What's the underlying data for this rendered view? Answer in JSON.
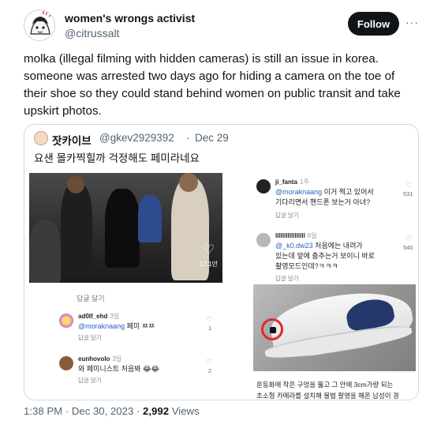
{
  "author": {
    "name": "women's wrongs activist",
    "handle": "@citrussalt"
  },
  "follow_label": "Follow",
  "more_label": "···",
  "tweet_text": "molka (illegal filming with hidden cameras) is still an issue in korea. someone was arrested two days ago for hiding a camera on the toe of their shoe so they could stand behind women on public transit and take upskirt photos.",
  "quote": {
    "name": "잣카이브",
    "handle": "@gkev2929392",
    "separator": "·",
    "date": "Dec 29",
    "text": "요샌 몰카찍힐까 걱정해도 페미라네요",
    "video": {
      "views": "17.1만"
    },
    "left_comments": [
      {
        "name": "ad0lf_ehd",
        "time": "3일",
        "mention": "@moraknaang",
        "text": " 페미 ㅉㅉ",
        "reply": "답글 달기",
        "likes": "1"
      },
      {
        "name": "eunhovolo",
        "time": "3일",
        "mention": "",
        "text": "와 페미니스트 처음봐 😂😂",
        "reply": "답글 달기",
        "likes": "2"
      }
    ],
    "left_cut_reply": "답글 달기",
    "right_comments": [
      {
        "name": "ji_fanta",
        "time": "1주",
        "mention": "@moraknaang",
        "line1": " 이거 찍고 있어서",
        "line2": "기다리면서 핸드폰 보는거 아녀?",
        "line3": "",
        "reply": "답글 달기",
        "likes": "531"
      },
      {
        "name": "lllllllllllllllll",
        "time": "6일",
        "mention": "@_k0.dw23",
        "line1": " 처음에는 내려가",
        "line2": "있는데 앞에 춤추는거 보이니 바로",
        "line3": "촬영모드인데?ㅋㅋㅋ",
        "reply": "답글 달기",
        "likes": "540"
      }
    ],
    "caption": {
      "line1": "운동화에 작은 구멍을 뚫고 그 안에 3cm가량 되는",
      "line2": "초소형 카메라를 설치해 불법 촬영을 해온 남성이 경"
    }
  },
  "meta": {
    "time": "1:38 PM",
    "sep1": " · ",
    "date": "Dec 30, 2023",
    "sep2": " · ",
    "views": "2,992",
    "views_label": " Views"
  },
  "colors": {
    "follow_bg": "#0f1419",
    "mention": "#2f60c9",
    "camera_highlight": "#e12a2a"
  }
}
